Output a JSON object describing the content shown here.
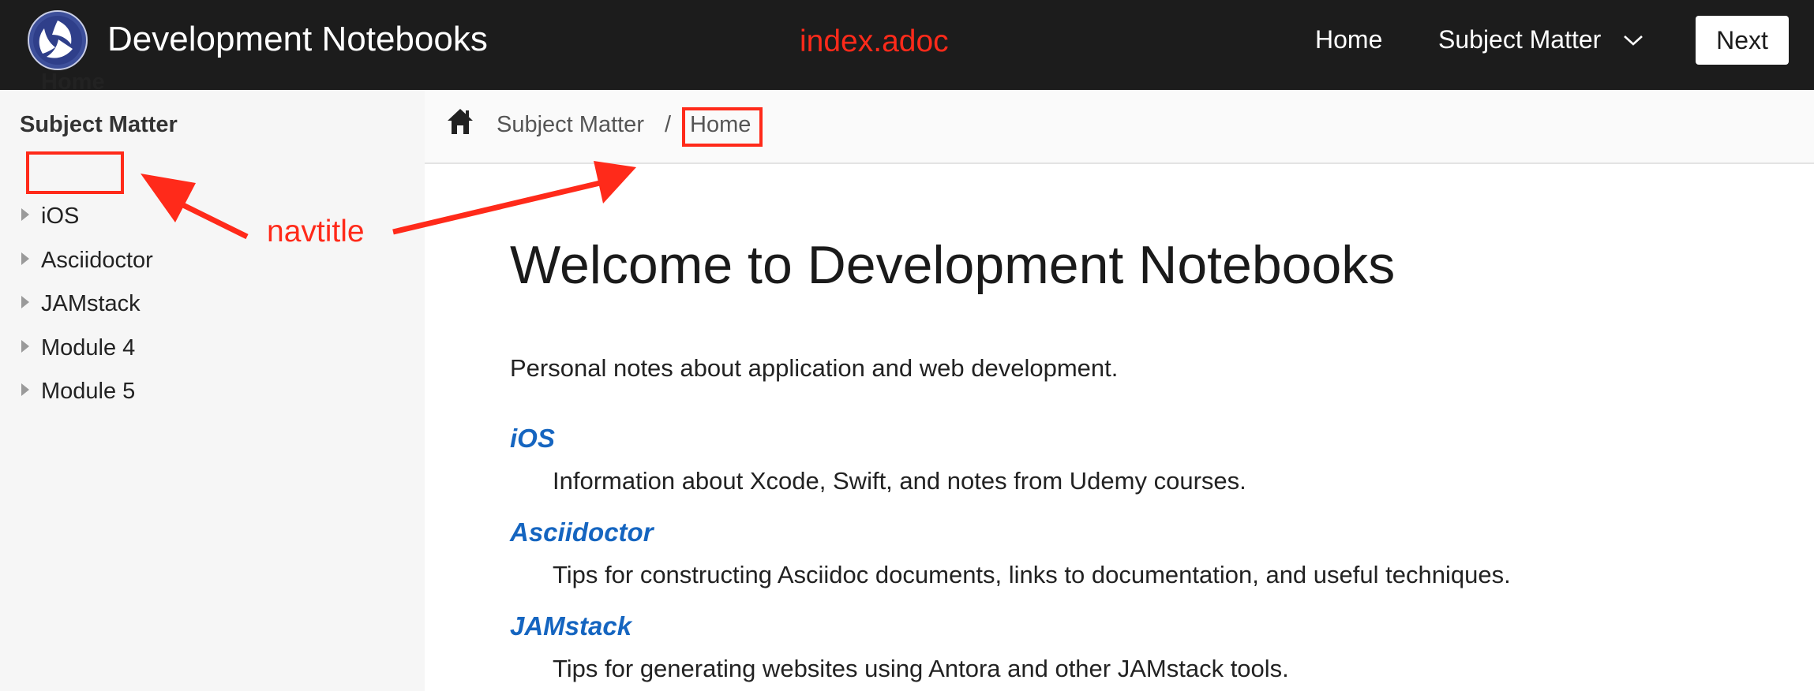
{
  "header": {
    "site_title": "Development Notebooks",
    "nav": {
      "home": "Home",
      "subject_matter": "Subject Matter"
    },
    "next_label": "Next"
  },
  "sidebar": {
    "heading": "Subject Matter",
    "items": [
      {
        "label": "Home"
      },
      {
        "label": "iOS"
      },
      {
        "label": "Asciidoctor"
      },
      {
        "label": "JAMstack"
      },
      {
        "label": "Module 4"
      },
      {
        "label": "Module 5"
      }
    ]
  },
  "breadcrumb": {
    "items": [
      "Subject Matter",
      "Home"
    ],
    "separator": "/"
  },
  "main": {
    "title": "Welcome to Development Notebooks",
    "intro": "Personal notes about application and web development.",
    "sections": [
      {
        "term": "iOS",
        "description": "Information about Xcode, Swift, and notes from Udemy courses."
      },
      {
        "term": "Asciidoctor",
        "description": "Tips for constructing Asciidoc documents, links to documentation, and useful techniques."
      },
      {
        "term": "JAMstack",
        "description": "Tips for generating websites using Antora and other JAMstack tools."
      }
    ]
  },
  "annotations": {
    "file_label": "index.adoc",
    "navtitle_label": "navtitle",
    "color": "#ff2a1a"
  },
  "colors": {
    "header_bg": "#1c1c1c",
    "sidebar_bg": "#f6f6f6",
    "link": "#1565c0"
  },
  "icons": {
    "logo": "logo-icon",
    "home": "home-icon",
    "dropdown": "chevron-down-icon",
    "expand": "triangle-right-icon"
  }
}
